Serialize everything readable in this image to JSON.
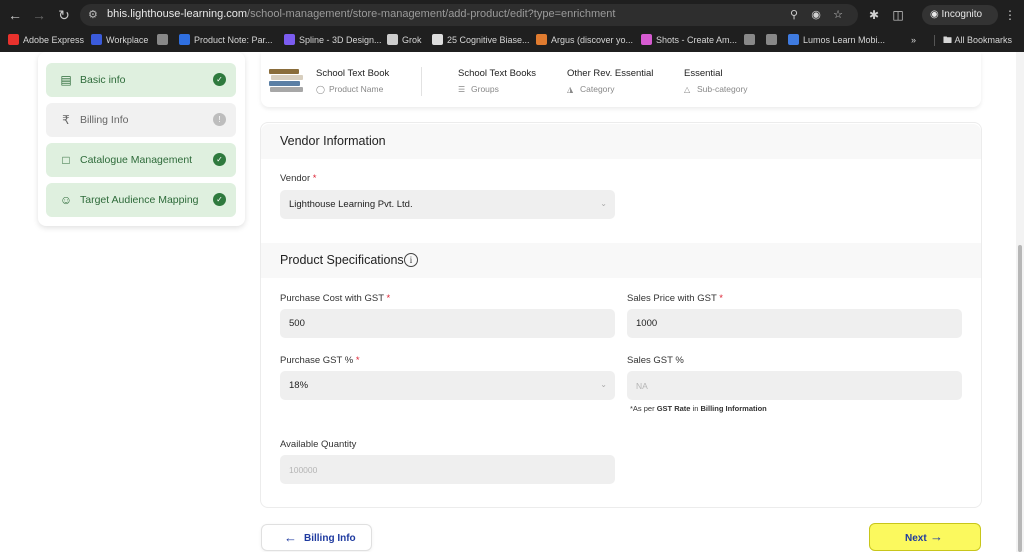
{
  "browser": {
    "url_host": "bhis.lighthouse-learning.com",
    "url_path": "/school-management/store-management/add-product/edit?type=enrichment",
    "incognito_label": "Incognito",
    "bookmarks": [
      {
        "label": "Adobe Express",
        "color": "#e9322d"
      },
      {
        "label": "Workplace",
        "color": "#3b5bdb"
      },
      {
        "label": "",
        "color": "#888888"
      },
      {
        "label": "Product Note: Par...",
        "color": "#2f6fe0"
      },
      {
        "label": "Spline - 3D Design...",
        "color": "#7b5cf0"
      },
      {
        "label": "Grok",
        "color": "#cccccc"
      },
      {
        "label": "25 Cognitive Biase...",
        "color": "#dddddd"
      },
      {
        "label": "Argus (discover yo...",
        "color": "#e07b2f"
      },
      {
        "label": "Shots - Create Am...",
        "color": "#d65bd1"
      },
      {
        "label": "",
        "color": "#888888"
      },
      {
        "label": "",
        "color": "#888888"
      },
      {
        "label": "Lumos Learn Mobi...",
        "color": "#3f7be0"
      }
    ],
    "all_bookmarks_label": "All Bookmarks"
  },
  "steps": [
    {
      "label": "Basic info",
      "status": "done",
      "icon": "clipboard-icon"
    },
    {
      "label": "Billing Info",
      "status": "pending",
      "icon": "rupee-icon"
    },
    {
      "label": "Catalogue Management",
      "status": "done",
      "icon": "box-icon"
    },
    {
      "label": "Target Audience Mapping",
      "status": "done",
      "icon": "user-target-icon"
    }
  ],
  "summary": {
    "product_name": "School Text Book",
    "product_name_label": "Product Name",
    "group": "School Text Books",
    "group_label": "Groups",
    "category": "Other Rev. Essential",
    "category_label": "Category",
    "sub_category": "Essential",
    "sub_category_label": "Sub-category"
  },
  "vendor": {
    "section_title": "Vendor Information",
    "label": "Vendor",
    "value": "Lighthouse Learning Pvt. Ltd."
  },
  "specs": {
    "section_title": "Product Specifications",
    "purchase_cost_label": "Purchase Cost with GST",
    "purchase_cost_value": "500",
    "sales_price_label": "Sales Price with GST",
    "sales_price_value": "1000",
    "purchase_gst_label": "Purchase GST %",
    "purchase_gst_value": "18%",
    "sales_gst_label": "Sales GST %",
    "sales_gst_placeholder": "NA",
    "note_prefix": "*As per",
    "note_bold1": "GST Rate",
    "note_mid": "in",
    "note_bold2": "Billing Information",
    "available_qty_label": "Available Quantity",
    "available_qty_placeholder": "100000"
  },
  "footer": {
    "back_label": "Billing Info",
    "next_label": "Next"
  },
  "colors": {
    "step_done_bg": "#dff0df",
    "step_done_text": "#2e6b3a",
    "next_button": "#fbf95e",
    "link_blue": "#1e3aa0",
    "required": "#dd2233"
  }
}
